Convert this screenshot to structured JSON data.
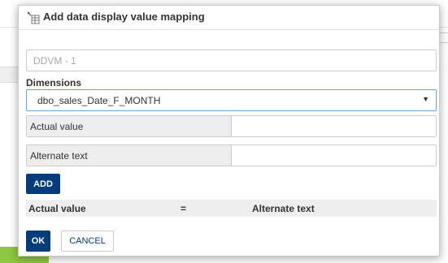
{
  "dialog": {
    "title": "Add data display value mapping",
    "icon": "table-settings-icon"
  },
  "name_field": {
    "placeholder": "DDVM - 1",
    "value": ""
  },
  "dimensions": {
    "label": "Dimensions",
    "selected": "dbo_sales_Date_F_MONTH",
    "arrow": "▼"
  },
  "actual_value": {
    "label": "Actual value",
    "value": ""
  },
  "alternate_text": {
    "label": "Alternate text",
    "value": ""
  },
  "buttons": {
    "add": "ADD",
    "ok": "OK",
    "cancel": "CANCEL"
  },
  "mapping_table": {
    "columns": [
      "Actual value",
      "=",
      "Alternate text"
    ]
  },
  "colors": {
    "primary": "#003d7a",
    "focus_border": "#66a3d9"
  }
}
